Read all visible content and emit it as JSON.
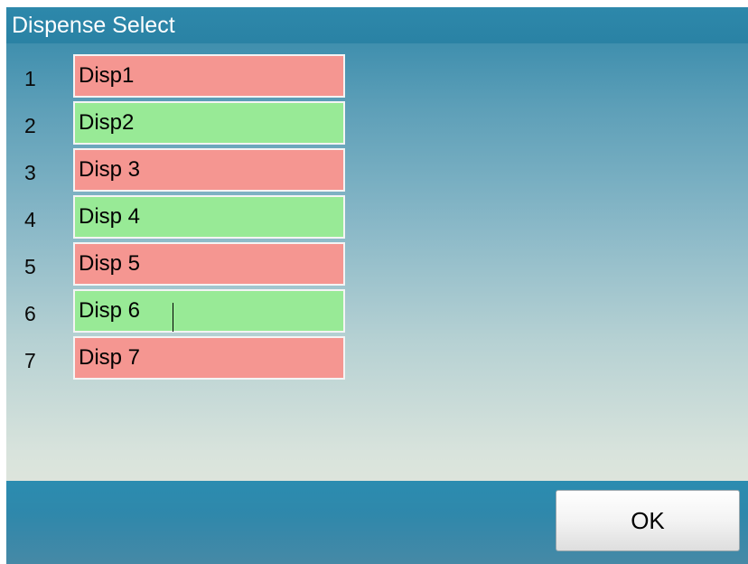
{
  "window": {
    "title": "Dispense Select"
  },
  "dispensers": [
    {
      "number": "1",
      "name": "Disp1",
      "status": "red"
    },
    {
      "number": "2",
      "name": "Disp2",
      "status": "green"
    },
    {
      "number": "3",
      "name": "Disp 3",
      "status": "red"
    },
    {
      "number": "4",
      "name": "Disp 4",
      "status": "green"
    },
    {
      "number": "5",
      "name": "Disp 5",
      "status": "red"
    },
    {
      "number": "6",
      "name": "Disp 6",
      "status": "green"
    },
    {
      "number": "7",
      "name": "Disp 7",
      "status": "red"
    }
  ],
  "colors": {
    "red": "#f59691",
    "green": "#98ea96",
    "titlebar": "#2d88ab"
  },
  "footer": {
    "ok_label": "OK"
  }
}
